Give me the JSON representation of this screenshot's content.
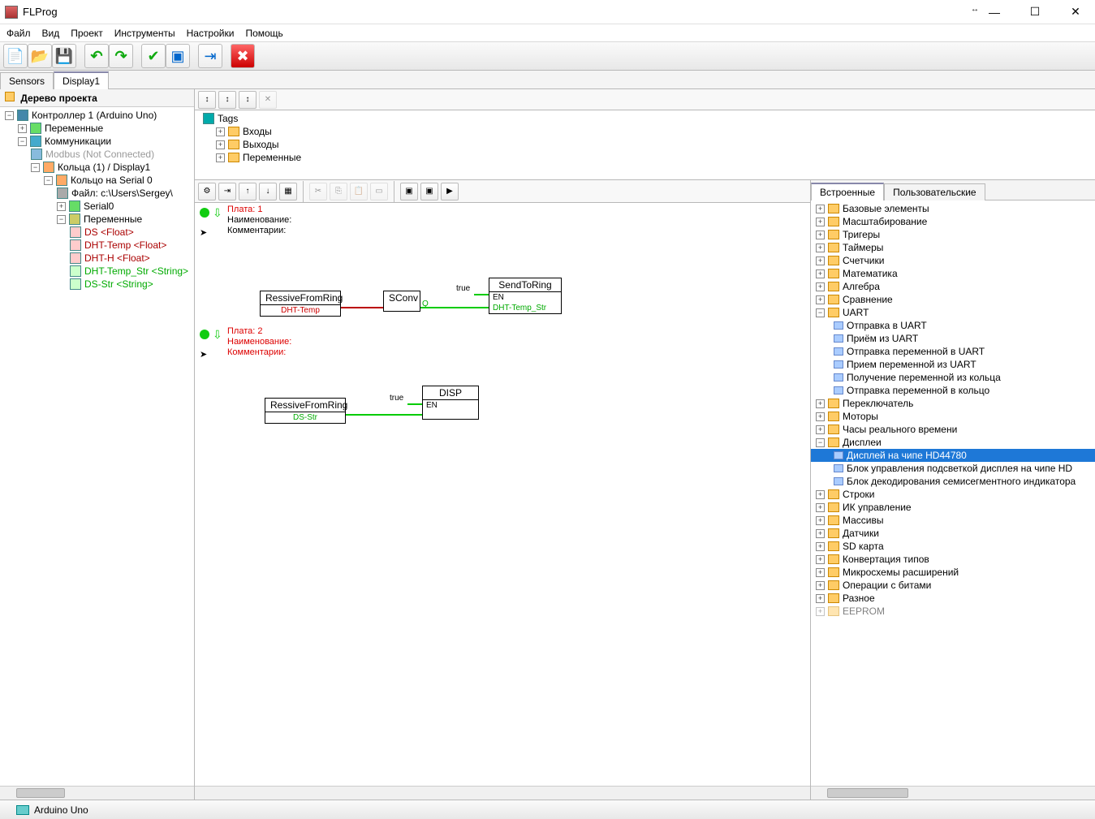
{
  "app": {
    "title": "FLProg"
  },
  "menu": [
    "Файл",
    "Вид",
    "Проект",
    "Инструменты",
    "Настройки",
    "Помощь"
  ],
  "footerTabs": [
    "Sensors",
    "Display1"
  ],
  "projectTree": {
    "header": "Дерево проекта",
    "controller": "Контроллер 1 (Arduino Uno)",
    "vars": "Переменные",
    "comms": "Коммуникации",
    "modbus": "Modbus (Not Connected)",
    "rings": "Кольца (1) / Display1",
    "ring0": "Кольцо  на Serial 0",
    "file": "Файл: c:\\Users\\Sergey\\",
    "serial": "Serial0",
    "ringVars": "Переменные",
    "v1": "DS <Float>",
    "v2": "DHT-Temp <Float>",
    "v3": "DHT-H <Float>",
    "v4": "DHT-Temp_Str <String>",
    "v5": "DS-Str <String>"
  },
  "tagPanel": {
    "tags": "Tags",
    "inputs": "Входы",
    "outputs": "Выходы",
    "vars": "Переменные"
  },
  "canvas": {
    "plate1": "Плата: 1",
    "naming": "Наименование:",
    "comments": "Комментарии:",
    "plate2": "Плата: 2",
    "block1": "RessiveFromRing",
    "block1var": "DHT-Temp",
    "block2": "SConv",
    "trueLabel": "true",
    "block3": "SendToRing",
    "block3pin": "EN",
    "block3var": "DHT-Temp_Str",
    "block4": "RessiveFromRing",
    "block4var": "DS-Str",
    "block5": "DISP",
    "block5pin": "EN",
    "qpin": "Q"
  },
  "rightTabs": [
    "Встроенные",
    "Пользовательские"
  ],
  "rightTree": {
    "n0": "Базовые элементы",
    "n1": "Масштабирование",
    "n2": "Тригеры",
    "n3": "Таймеры",
    "n4": "Счетчики",
    "n5": "Математика",
    "n6": "Алгебра",
    "n7": "Сравнение",
    "n8": "UART",
    "n8a": "Отправка в UART",
    "n8b": "Приём из UART",
    "n8c": "Отправка переменной в UART",
    "n8d": "Прием переменной из UART",
    "n8e": "Получение переменной из кольца",
    "n8f": "Отправка переменной в кольцо",
    "n9": "Переключатель",
    "n10": "Моторы",
    "n11": "Часы реального времени",
    "n12": "Дисплеи",
    "n12a": "Дисплей на чипе HD44780",
    "n12b": "Блок управления подсветкой дисплея на чипе HD",
    "n12c": "Блок декодирования семисегментного индикатора",
    "n13": "Строки",
    "n14": "ИК управление",
    "n15": "Массивы",
    "n16": "Датчики",
    "n17": "SD карта",
    "n18": "Конвертация типов",
    "n19": "Микросхемы расширений",
    "n20": "Операции с битами",
    "n21": "Разное",
    "n22": "EEPROM"
  },
  "status": {
    "board": "Arduino Uno"
  }
}
